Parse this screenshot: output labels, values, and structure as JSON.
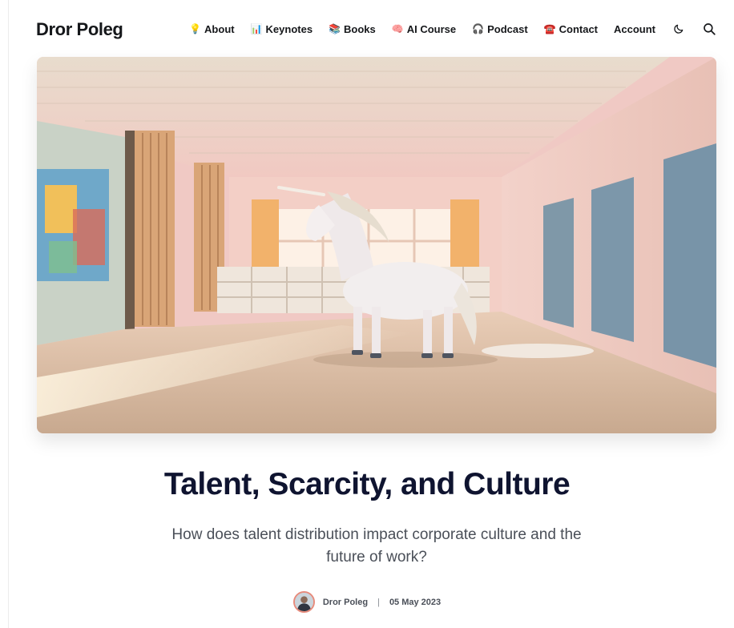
{
  "site": {
    "brand": "Dror Poleg"
  },
  "nav": {
    "items": [
      {
        "emoji": "💡",
        "label": "About"
      },
      {
        "emoji": "📊",
        "label": "Keynotes"
      },
      {
        "emoji": "📚",
        "label": "Books"
      },
      {
        "emoji": "🧠",
        "label": "AI Course"
      },
      {
        "emoji": "🎧",
        "label": "Podcast"
      },
      {
        "emoji": "☎️",
        "label": "Contact"
      }
    ],
    "account_label": "Account",
    "icons": {
      "theme": "moon-icon",
      "search": "search-icon"
    }
  },
  "article": {
    "title": "Talent, Scarcity, and Culture",
    "subtitle": "How does talent distribution impact corporate culture and the future of work?",
    "author": "Dror Poleg",
    "separator": "|",
    "date": "05 May 2023"
  },
  "colors": {
    "text": "#15171a",
    "title": "#0f1430",
    "muted": "#4a4f58",
    "avatar_ring": "#e78b7c"
  }
}
